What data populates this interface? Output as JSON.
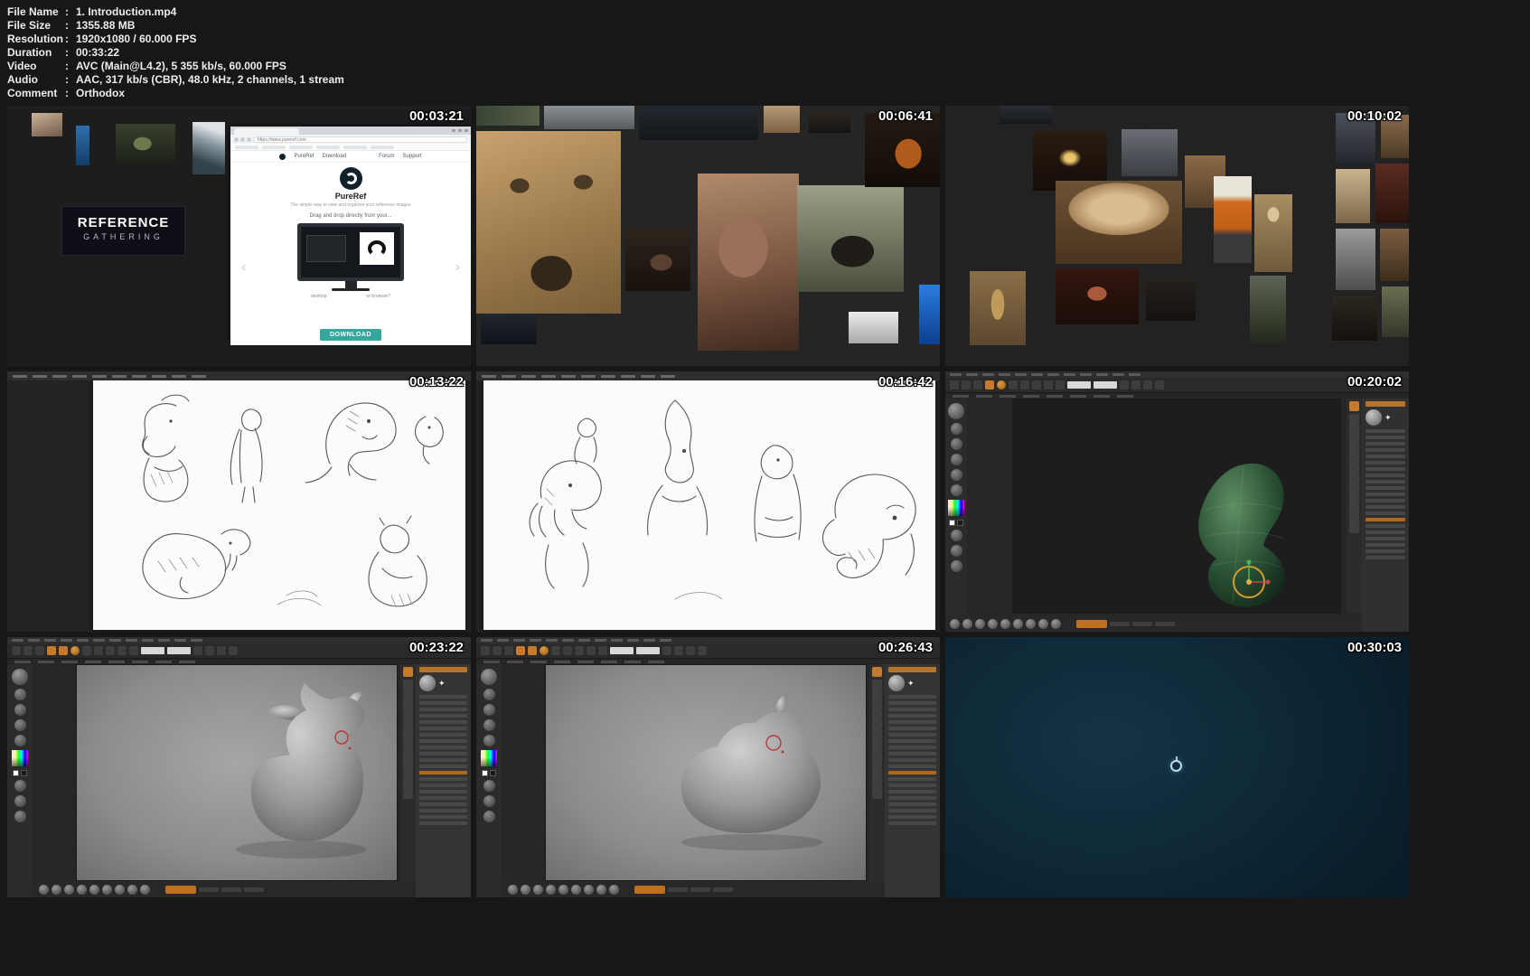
{
  "sheet": {
    "background": "#171717"
  },
  "metadata": {
    "colon": ":",
    "rows": [
      {
        "label": "File Name",
        "value": "1. Introduction.mp4"
      },
      {
        "label": "File Size",
        "value": "1355.88 MB"
      },
      {
        "label": "Resolution",
        "value": "1920x1080 / 60.000 FPS"
      },
      {
        "label": "Duration",
        "value": "00:33:22"
      },
      {
        "label": "Video",
        "value": "AVC (Main@L4.2), 5 355 kb/s, 60.000 FPS"
      },
      {
        "label": "Audio",
        "value": "AAC, 317 kb/s (CBR), 48.0 kHz, 2 channels, 1 stream"
      },
      {
        "label": "Comment",
        "value": "Orthodox"
      }
    ]
  },
  "thumbnails": [
    {
      "timestamp": "00:03:21"
    },
    {
      "timestamp": "00:06:41"
    },
    {
      "timestamp": "00:10:02"
    },
    {
      "timestamp": "00:13:22"
    },
    {
      "timestamp": "00:16:42"
    },
    {
      "timestamp": "00:20:02"
    },
    {
      "timestamp": "00:23:22"
    },
    {
      "timestamp": "00:26:43"
    },
    {
      "timestamp": "00:30:03"
    }
  ],
  "pureref": {
    "url": "https://www.pureref.com",
    "reference_line1": "REFERENCE",
    "reference_line2": "GATHERING",
    "nav": [
      "PureRef",
      "Download",
      "Forum",
      "Support"
    ],
    "title": "PureRef",
    "tagline": "The simple way to view and organize your reference images",
    "drag_text": "Drag and drop directly from your...",
    "desktop_label": "desktop",
    "browser_label": "or browser?",
    "download_label": "DOWNLOAD"
  },
  "icons": {
    "carousel_left": "‹",
    "carousel_right": "›",
    "star": "✦"
  },
  "colors": {
    "accent_orange": "#c77b2a",
    "download_teal": "#35a79c",
    "timestamp_text": "#ffffff",
    "timestamp_outline": "#000000"
  }
}
